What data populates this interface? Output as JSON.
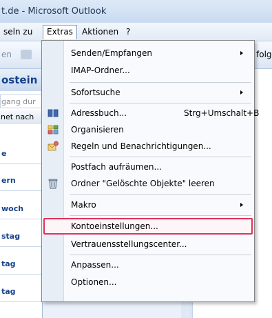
{
  "window": {
    "title": "t.de - Microsoft Outlook"
  },
  "menubar": {
    "items": [
      {
        "label": "seln zu"
      },
      {
        "label": "Extras"
      },
      {
        "label": "Aktionen"
      },
      {
        "label": "?"
      }
    ]
  },
  "toolbar": {
    "left_text": "en",
    "right_text": "folg"
  },
  "left_pane": {
    "header": "ostein",
    "search_placeholder": "gang dur",
    "arrange_label": "net nach",
    "groups": [
      "e",
      "ern",
      "woch",
      "stag",
      "tag",
      "tag"
    ]
  },
  "extras_menu": {
    "items": [
      {
        "label": "Senden/Empfangen",
        "submenu": true
      },
      {
        "label": "IMAP-Ordner..."
      },
      {
        "label": "Sofortsuche",
        "submenu": true
      },
      {
        "label": "Adressbuch...",
        "shortcut": "Strg+Umschalt+B",
        "icon": "address-book-icon"
      },
      {
        "label": "Organisieren",
        "icon": "organize-icon"
      },
      {
        "label": "Regeln und Benachrichtigungen...",
        "icon": "rules-icon"
      },
      {
        "label": "Postfach aufräumen..."
      },
      {
        "label": "Ordner \"Gelöschte Objekte\" leeren",
        "icon": "empty-trash-icon"
      },
      {
        "label": "Makro",
        "submenu": true
      },
      {
        "label": "Kontoeinstellungen...",
        "highlighted": true
      },
      {
        "label": "Vertrauensstellungscenter..."
      },
      {
        "label": "Anpassen..."
      },
      {
        "label": "Optionen..."
      }
    ]
  },
  "colors": {
    "highlight_border": "#e0325a",
    "accent": "#15428b"
  }
}
